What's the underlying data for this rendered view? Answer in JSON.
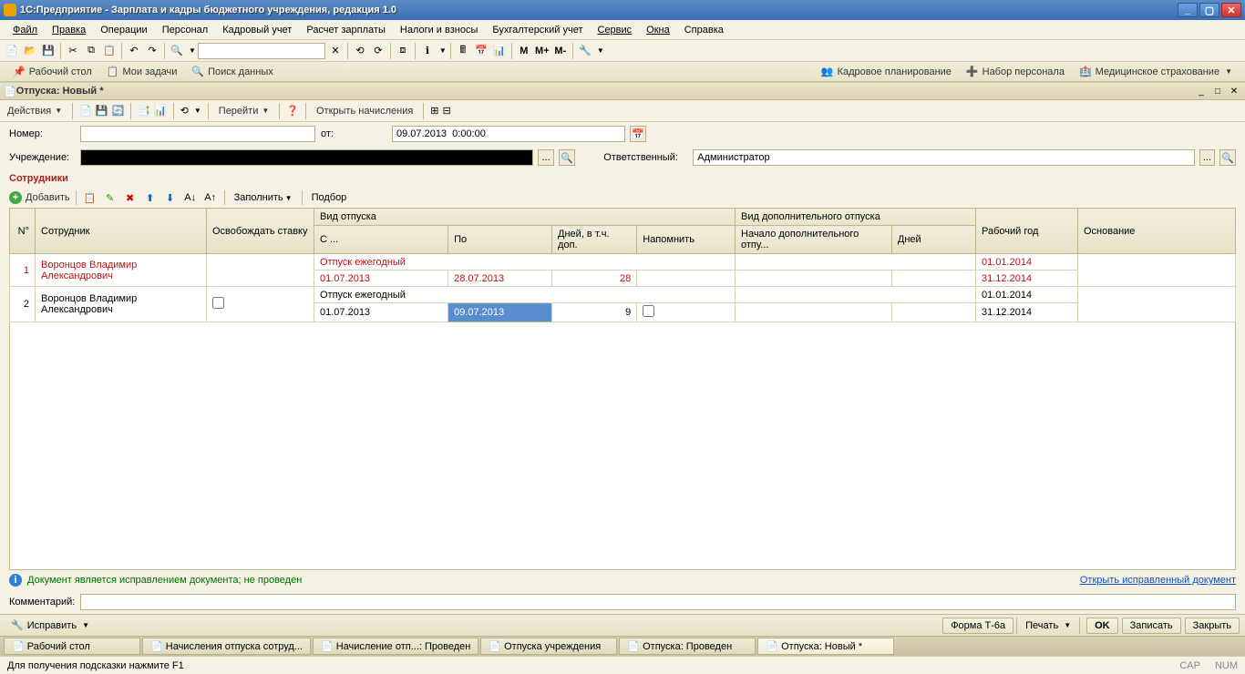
{
  "app_title": "1С:Предприятие - Зарплата и кадры бюджетного учреждения, редакция 1.0",
  "menus": [
    "Файл",
    "Правка",
    "Операции",
    "Персонал",
    "Кадровый учет",
    "Расчет зарплаты",
    "Налоги и взносы",
    "Бухгалтерский учет",
    "Сервис",
    "Окна",
    "Справка"
  ],
  "toolbar_m_labels": [
    "M",
    "M+",
    "M-"
  ],
  "nav": {
    "desktop": "Рабочий стол",
    "tasks": "Мои задачи",
    "search": "Поиск данных",
    "kadplan": "Кадровое планирование",
    "nabor": "Набор персонала",
    "med": "Медицинское страхование"
  },
  "doc": {
    "title": "Отпуска: Новый *"
  },
  "doc_toolbar": {
    "actions": "Действия",
    "goto": "Перейти",
    "open_acc": "Открыть начисления"
  },
  "form": {
    "number_label": "Номер:",
    "number": "",
    "from_label": "от:",
    "from": "09.07.2013  0:00:00",
    "org_label": "Учреждение:",
    "org": "",
    "resp_label": "Ответственный:",
    "resp": "Администратор"
  },
  "section": "Сотрудники",
  "table_toolbar": {
    "add": "Добавить",
    "fill": "Заполнить",
    "select": "Подбор"
  },
  "columns": {
    "num": "N°",
    "emp": "Сотрудник",
    "release": "Освобождать ставку",
    "kind": "Вид отпуска",
    "addkind": "Вид дополнительного отпуска",
    "year": "Рабочий год",
    "basis": "Основание",
    "from": "С ...",
    "to": "По",
    "days": "Дней, в т.ч. доп.",
    "remind": "Напомнить",
    "addstart": "Начало дополнительного отпу...",
    "adddays": "Дней"
  },
  "rows": [
    {
      "num": "1",
      "emp": "Воронцов  Владимир Александрович",
      "release": false,
      "kind": "Отпуск ежегодный",
      "from": "01.07.2013",
      "to": "28.07.2013",
      "days": "28",
      "remind": "",
      "year_from": "01.01.2014",
      "year_to": "31.12.2014",
      "red": true
    },
    {
      "num": "2",
      "emp": "Воронцов  Владимир Александрович",
      "release": false,
      "kind": "Отпуск ежегодный",
      "from": "01.07.2013",
      "to": "09.07.2013",
      "days": "9",
      "remind": false,
      "year_from": "01.01.2014",
      "year_to": "31.12.2014",
      "red": false,
      "selected_to": true
    }
  ],
  "info_text": "Документ является исправлением документа; не проведен",
  "info_link": "Открыть исправленный документ",
  "comment_label": "Комментарий:",
  "comment": "",
  "bottom": {
    "fix": "Исправить",
    "form_t6a": "Форма Т-6а",
    "print": "Печать",
    "ok": "OK",
    "save": "Записать",
    "close": "Закрыть"
  },
  "tasks": [
    "Рабочий стол",
    "Начисления отпуска сотруд...",
    "Начисление отп...: Проведен",
    "Отпуска учреждения",
    "Отпуска: Проведен",
    "Отпуска: Новый *"
  ],
  "task_active_index": 5,
  "status_hint": "Для получения подсказки нажмите F1",
  "status_cap": "CAP",
  "status_num": "NUM"
}
